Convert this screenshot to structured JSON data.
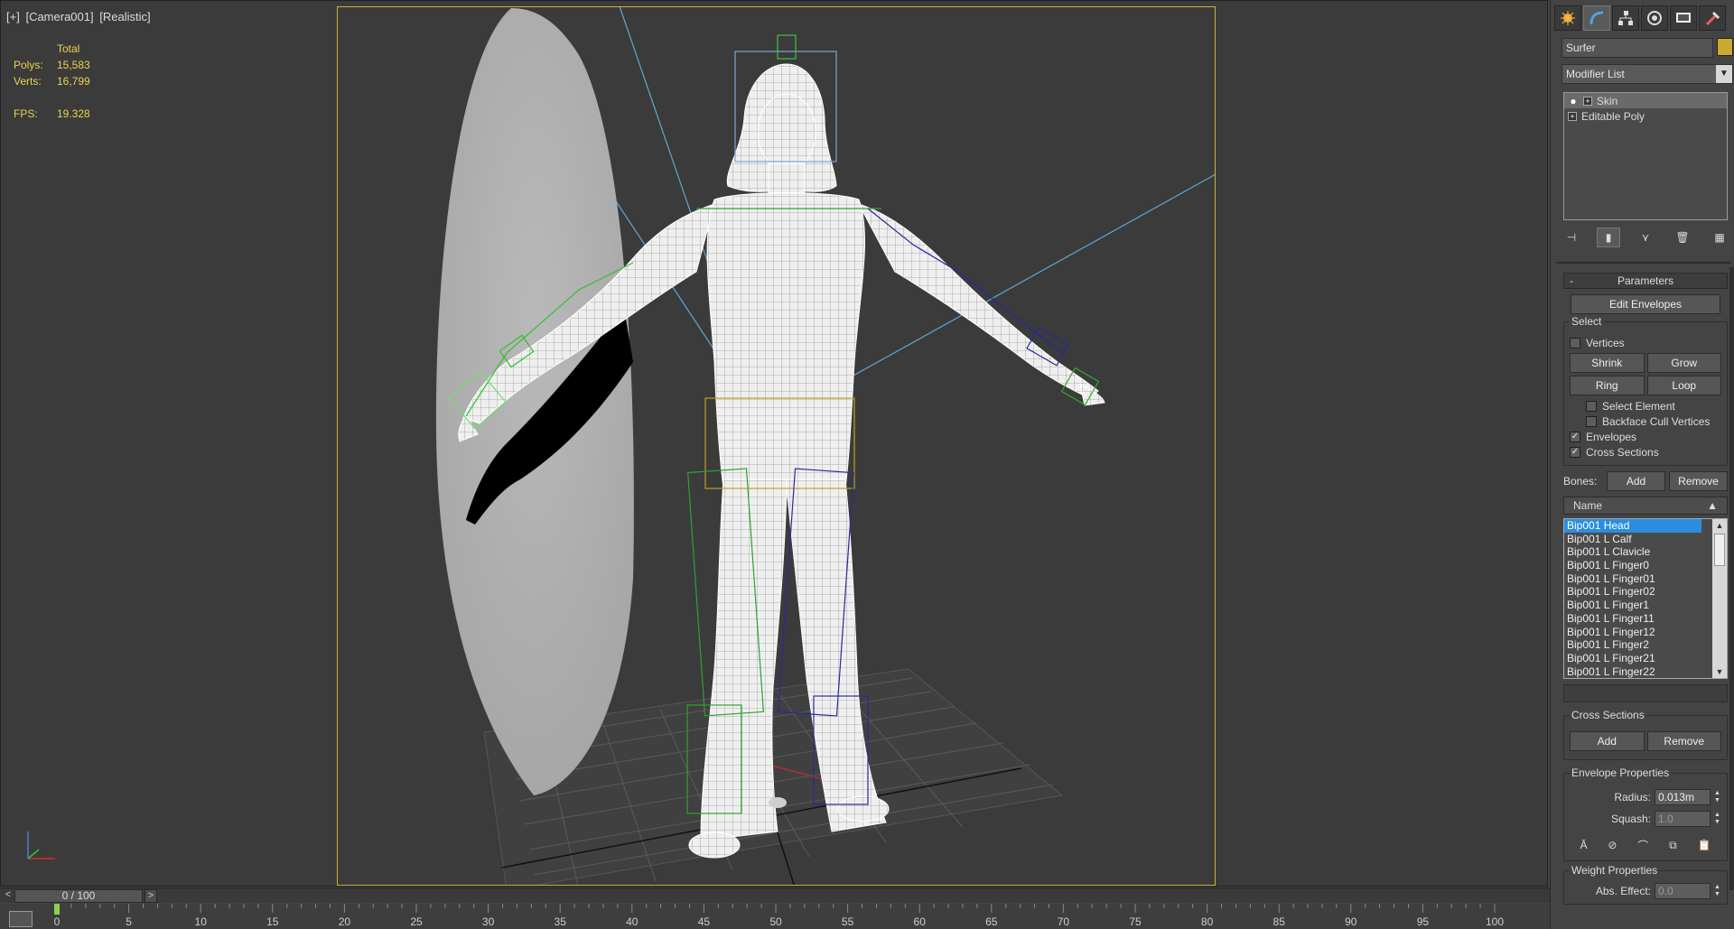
{
  "viewport": {
    "labels": [
      "[+]",
      "[Camera001]",
      "[Realistic]"
    ],
    "stats": {
      "header": "Total",
      "polys_label": "Polys:",
      "polys": "15,583",
      "verts_label": "Verts:",
      "verts": "16,799",
      "fps_label": "FPS:",
      "fps": "19.328"
    }
  },
  "command_panel": {
    "tabs": [
      "create-tab",
      "modify-tab",
      "hierarchy-tab",
      "motion-tab",
      "display-tab",
      "utilities-tab"
    ],
    "object_name": "Surfer",
    "object_color": "#c9a92f",
    "modifier_list": "Modifier List",
    "stack": [
      {
        "label": "Skin"
      },
      {
        "label": "Editable Poly"
      }
    ],
    "parameters": {
      "title": "Parameters",
      "collapse": "-",
      "edit_envelopes": "Edit Envelopes",
      "select_group": "Select",
      "vertices": "Vertices",
      "shrink": "Shrink",
      "grow": "Grow",
      "ring": "Ring",
      "loop": "Loop",
      "select_element": "Select Element",
      "backface_cull": "Backface Cull Vertices",
      "envelopes": "Envelopes",
      "cross_sections": "Cross Sections",
      "bones_label": "Bones:",
      "add": "Add",
      "remove": "Remove",
      "name_header": "Name",
      "sort_arrow": "▲",
      "bones": [
        "Bip001 Head",
        "Bip001 L Calf",
        "Bip001 L Clavicle",
        "Bip001 L Finger0",
        "Bip001 L Finger01",
        "Bip001 L Finger02",
        "Bip001 L Finger1",
        "Bip001 L Finger11",
        "Bip001 L Finger12",
        "Bip001 L Finger2",
        "Bip001 L Finger21",
        "Bip001 L Finger22"
      ],
      "cross_sections_group": "Cross Sections",
      "cs_add": "Add",
      "cs_remove": "Remove",
      "envelope_props": "Envelope Properties",
      "radius_label": "Radius:",
      "radius": "0.013m",
      "squash_label": "Squash:",
      "squash": "1.0",
      "weight_props": "Weight Properties",
      "abs_effect_label": "Abs. Effect:",
      "abs_effect": "0.0"
    }
  },
  "time_slider": {
    "prev": "<",
    "next": ">",
    "frame": "0 / 100"
  },
  "trackbar": {
    "ticks": [
      "0",
      "5",
      "10",
      "15",
      "20",
      "25",
      "30",
      "35",
      "40",
      "45",
      "50",
      "55",
      "60",
      "65",
      "70",
      "75",
      "80",
      "85",
      "90",
      "95",
      "100"
    ]
  }
}
